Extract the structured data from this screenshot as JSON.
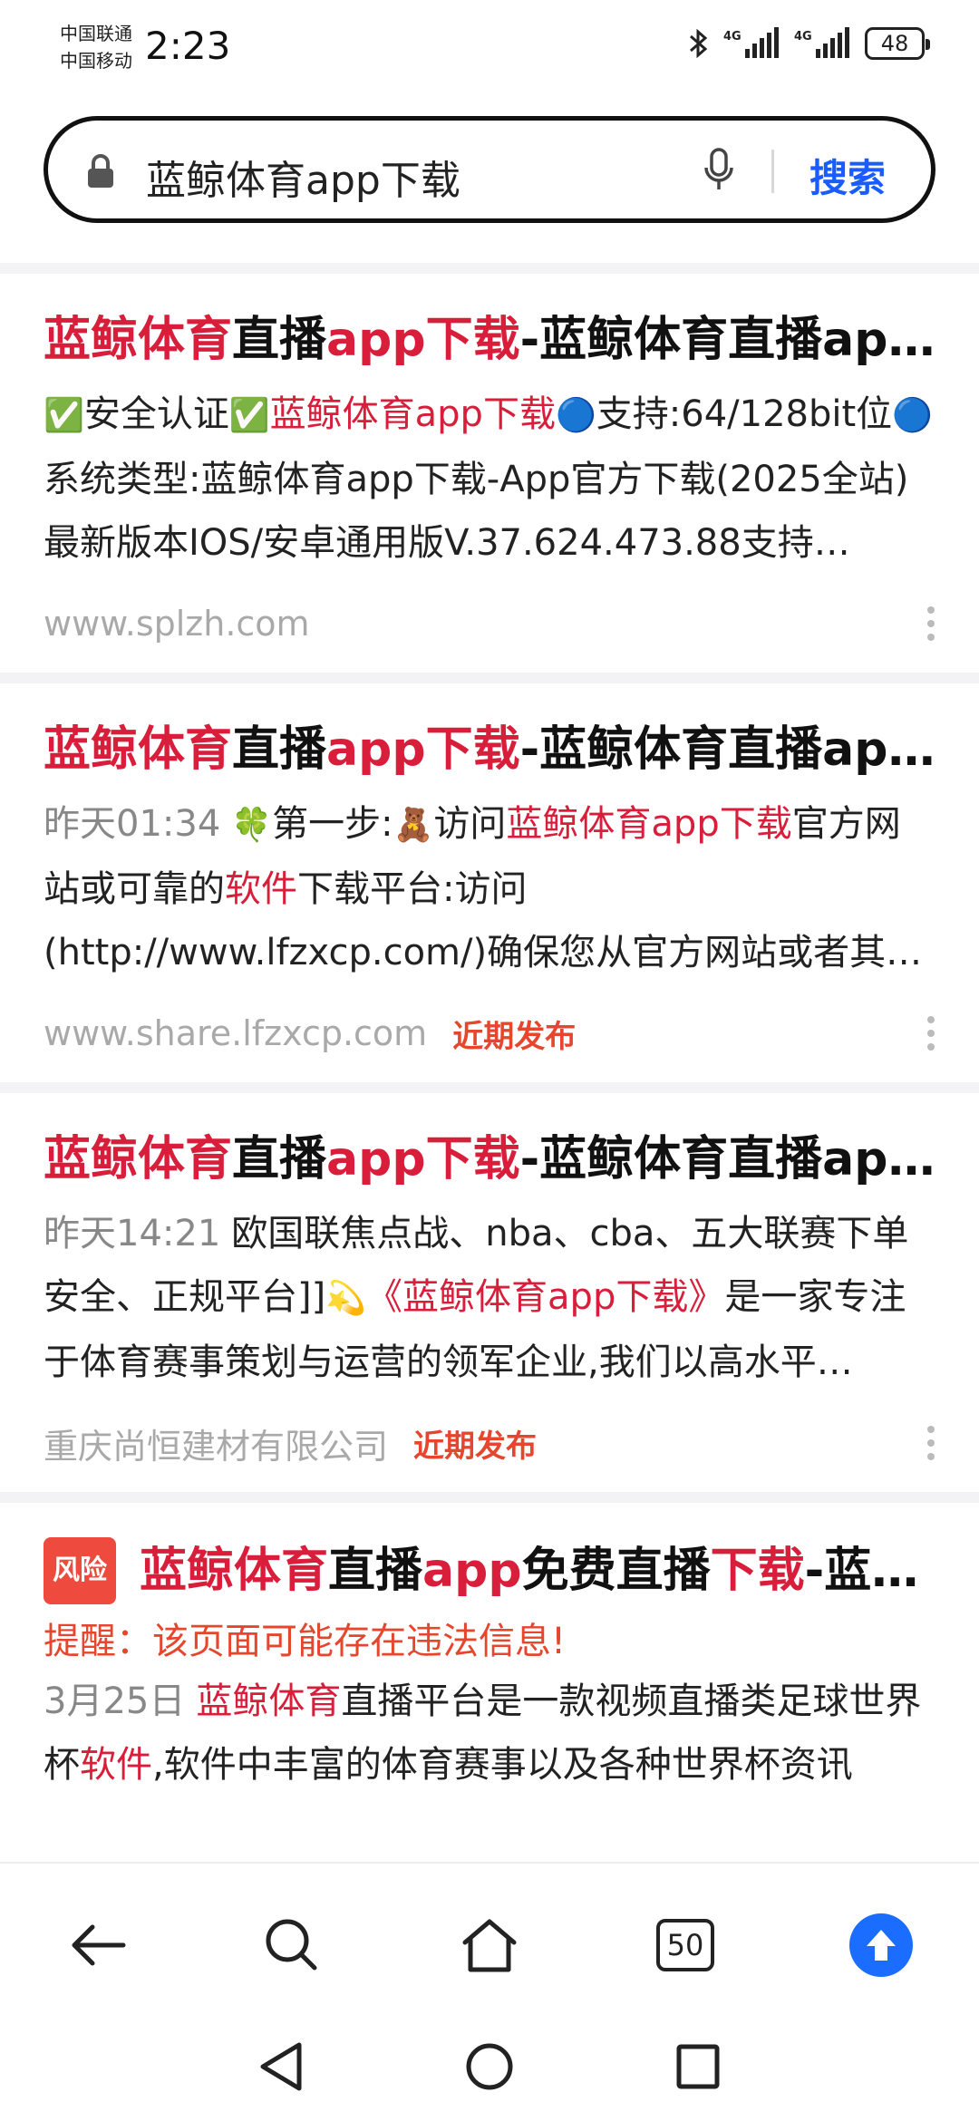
{
  "status_bar": {
    "carrier_1": "中国联通",
    "carrier_2": "中国移动",
    "time": "2:23",
    "network_1": "4G",
    "network_2": "4G",
    "battery": "48"
  },
  "search": {
    "query": "蓝鲸体育app下载",
    "button_label": "搜索"
  },
  "results": [
    {
      "title": [
        {
          "t": "蓝鲸体育",
          "hl": true
        },
        {
          "t": "直播",
          "hl": false
        },
        {
          "t": "app下载",
          "hl": true
        },
        {
          "t": "-蓝鲸体育直播app下载",
          "hl": false
        }
      ],
      "snippet": [
        {
          "t": "✅",
          "emoji": true
        },
        {
          "t": "安全认证",
          "hl": false
        },
        {
          "t": "✅",
          "emoji": true
        },
        {
          "t": "蓝鲸体育app下载",
          "hl": true
        },
        {
          "t": "🔵",
          "emoji": true
        },
        {
          "t": "支持:64/128bit位",
          "hl": false
        },
        {
          "t": "🔵",
          "emoji": true
        },
        {
          "t": "系统类型:蓝鲸体育app下载-App官方下载(2025全站)最新版本IOS/安卓通用版V.37.624.473.88支持…",
          "hl": false
        }
      ],
      "source": "www.splzh.com",
      "tag": ""
    },
    {
      "title": [
        {
          "t": "蓝鲸体育",
          "hl": true
        },
        {
          "t": "直播",
          "hl": false
        },
        {
          "t": "app下载",
          "hl": true
        },
        {
          "t": "-蓝鲸体育直播app下载",
          "hl": false
        }
      ],
      "date": "昨天01:34",
      "snippet": [
        {
          "t": "🍀",
          "emoji": true
        },
        {
          "t": "第一步:",
          "hl": false
        },
        {
          "t": "🧸",
          "emoji": true
        },
        {
          "t": "访问",
          "hl": false
        },
        {
          "t": "蓝鲸体育app下载",
          "hl": true
        },
        {
          "t": "官方网站或可靠的",
          "hl": false
        },
        {
          "t": "软件",
          "hl": true
        },
        {
          "t": "下载平台:访问(http://www.lfzxcp.com/)确保您从官方网站或者其…",
          "hl": false
        }
      ],
      "source": "www.share.lfzxcp.com",
      "tag": "近期发布"
    },
    {
      "title": [
        {
          "t": "蓝鲸体育",
          "hl": true
        },
        {
          "t": "直播",
          "hl": false
        },
        {
          "t": "app下载",
          "hl": true
        },
        {
          "t": "-蓝鲸体育直播app下载",
          "hl": false
        }
      ],
      "date": "昨天14:21",
      "snippet": [
        {
          "t": "欧国联焦点战、nba、cba、五大联赛下单安全、正规平台]]",
          "hl": false
        },
        {
          "t": "💫",
          "emoji": true
        },
        {
          "t": "《蓝鲸体育app下载》",
          "hl": true
        },
        {
          "t": "是一家专注于体育赛事策划与运营的领军企业,我们以高水平…",
          "hl": false
        }
      ],
      "source": "重庆尚恒建材有限公司",
      "tag": "近期发布"
    },
    {
      "badge": "风险",
      "title": [
        {
          "t": "蓝鲸体育",
          "hl": true
        },
        {
          "t": "直播",
          "hl": false
        },
        {
          "t": "app",
          "hl": true
        },
        {
          "t": "免费直播",
          "hl": false
        },
        {
          "t": "下载",
          "hl": true
        },
        {
          "t": "-蓝鲸体育直播app免费直播下载",
          "hl": false
        }
      ],
      "warning": "提醒：该页面可能存在违法信息!",
      "date": "3月25日",
      "snippet": [
        {
          "t": "蓝鲸体育",
          "hl": true
        },
        {
          "t": "直播平台是一款视频直播类足球世界杯",
          "hl": false
        },
        {
          "t": "软件",
          "hl": true
        },
        {
          "t": ",软件中丰富的体育赛事以及各种世界杯资讯",
          "hl": false
        }
      ],
      "source": "",
      "tag": ""
    }
  ],
  "bottom_nav": {
    "tab_count": "50"
  }
}
